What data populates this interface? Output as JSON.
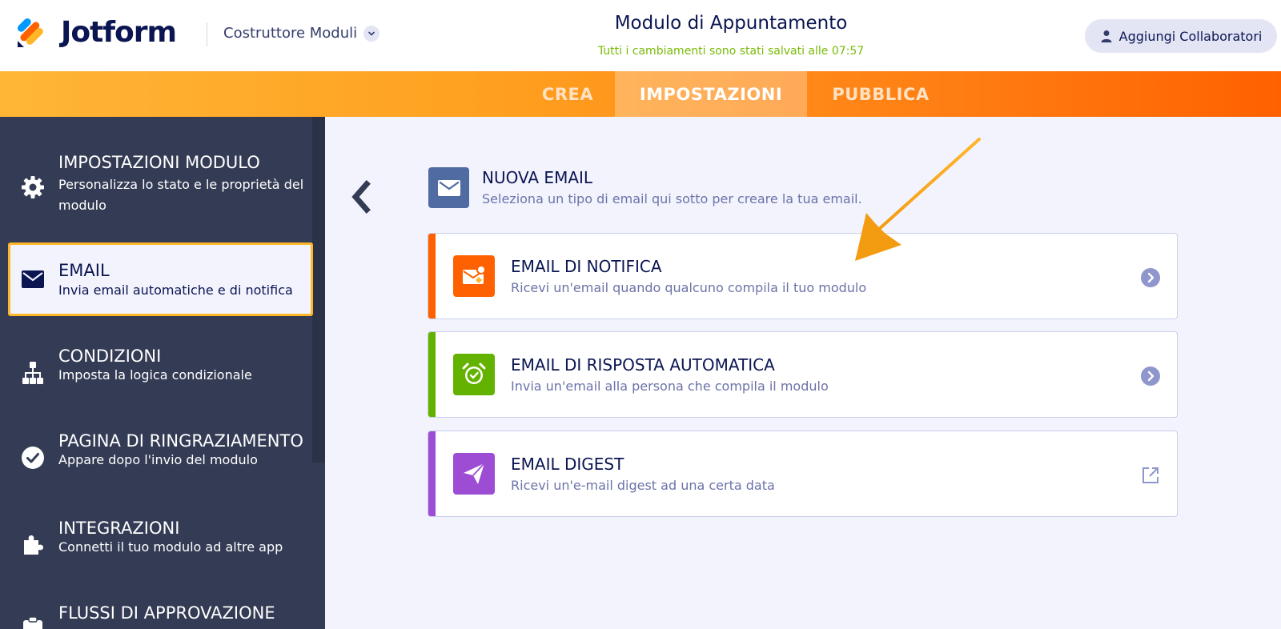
{
  "header": {
    "brand": "Jotform",
    "builder_label": "Costruttore Moduli",
    "form_title": "Modulo di Appuntamento",
    "save_status": "Tutti i cambiamenti sono stati salvati alle 07:57",
    "collaborators_button": "Aggiungi Collaboratori"
  },
  "nav": {
    "tabs": [
      {
        "label": "CREA",
        "active": false
      },
      {
        "label": "IMPOSTAZIONI",
        "active": true
      },
      {
        "label": "PUBBLICA",
        "active": false
      }
    ]
  },
  "sidebar": {
    "items": [
      {
        "title": "IMPOSTAZIONI MODULO",
        "desc": "Personalizza lo stato e le proprietà del modulo",
        "icon": "gear-icon"
      },
      {
        "title": "EMAIL",
        "desc": "Invia email automatiche e di notifica",
        "icon": "envelope-icon",
        "active": true
      },
      {
        "title": "CONDIZIONI",
        "desc": "Imposta la logica condizionale",
        "icon": "sitemap-icon"
      },
      {
        "title": "PAGINA DI RINGRAZIAMENTO",
        "desc": "Appare dopo l'invio del modulo",
        "icon": "check-circle-icon"
      },
      {
        "title": "INTEGRAZIONI",
        "desc": "Connetti il tuo modulo ad altre app",
        "icon": "puzzle-icon"
      },
      {
        "title": "FLUSSI DI APPROVAZIONE",
        "desc": "",
        "icon": "approval-icon"
      }
    ]
  },
  "main": {
    "new_email": {
      "title": "NUOVA EMAIL",
      "desc": "Seleziona un tipo di email qui sotto per creare la tua email."
    },
    "cards": [
      {
        "title": "EMAIL DI NOTIFICA",
        "desc": "Ricevi un'email quando qualcuno compila il tuo modulo",
        "color": "#ff6100",
        "icon": "notification-mail-icon",
        "action": "chevron-right-icon"
      },
      {
        "title": "EMAIL DI RISPOSTA AUTOMATICA",
        "desc": "Invia un'email alla persona che compila il modulo",
        "color": "#64b200",
        "icon": "alarm-clock-icon",
        "action": "chevron-right-icon"
      },
      {
        "title": "EMAIL DIGEST",
        "desc": "Ricevi un'e-mail digest ad una certa data",
        "color": "#9c4dd3",
        "icon": "paper-plane-icon",
        "action": "external-link-icon"
      }
    ]
  },
  "colors": {
    "accent_orange": "#ff6100",
    "sidebar_bg": "#343c55",
    "active_border": "#ffb629",
    "save_green": "#78bb07"
  }
}
